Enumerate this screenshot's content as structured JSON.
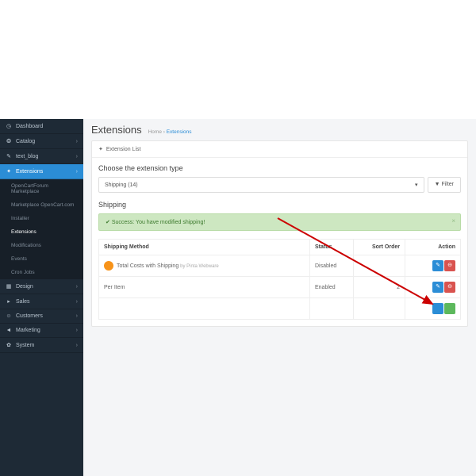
{
  "sidebar": {
    "items": [
      {
        "label": "Dashboard",
        "icon": "◷"
      },
      {
        "label": "Catalog",
        "icon": "❂"
      },
      {
        "label": "text_blog",
        "icon": "✎"
      },
      {
        "label": "Extensions",
        "icon": "✦",
        "active": true
      },
      {
        "label": "Design",
        "icon": "▦"
      },
      {
        "label": "Sales",
        "icon": "▸"
      },
      {
        "label": "Customers",
        "icon": "☺"
      },
      {
        "label": "Marketing",
        "icon": "◄"
      },
      {
        "label": "System",
        "icon": "✿"
      }
    ],
    "sub": [
      {
        "label": "OpenCartForum Marketplace"
      },
      {
        "label": "Marketplace OpenCart.com"
      },
      {
        "label": "Installer"
      },
      {
        "label": "Extensions",
        "active": true
      },
      {
        "label": "Modifications"
      },
      {
        "label": "Events"
      },
      {
        "label": "Cron Jobs"
      }
    ]
  },
  "header": {
    "title": "Extensions",
    "home": "Home",
    "current": "Extensions"
  },
  "panel": {
    "list_title": "Extension List",
    "choose": "Choose the extension type",
    "select_value": "Shipping (14)",
    "filter": "Filter",
    "section": "Shipping",
    "alert": "Success: You have modified shipping!"
  },
  "table": {
    "cols": {
      "method": "Shipping Method",
      "status": "Status",
      "sort": "Sort Order",
      "action": "Action"
    },
    "rows": [
      {
        "name": "Total Costs with Shipping",
        "by": "by Pinta Webware",
        "status": "Disabled",
        "sort": "",
        "icon": true
      },
      {
        "name": "Per Item",
        "by": "",
        "status": "Enabled",
        "sort": "2",
        "icon": false
      }
    ]
  }
}
